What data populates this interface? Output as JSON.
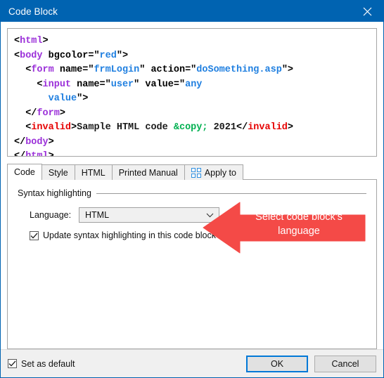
{
  "window": {
    "title": "Code Block",
    "close_icon": "close-icon",
    "titlebar_color": "#0063b1"
  },
  "code_preview": {
    "language_shown": "HTML",
    "colors": {
      "tag": "#9b30d9",
      "invalid_tag": "#e60000",
      "attribute_value": "#1f7fe0",
      "entity": "#00b050",
      "punctuation": "#000000",
      "text": "#1a1a1a"
    },
    "lines": [
      {
        "indent": 0,
        "tokens": [
          {
            "t": "punct",
            "s": "<"
          },
          {
            "t": "tag",
            "s": "html"
          },
          {
            "t": "punct",
            "s": ">"
          }
        ]
      },
      {
        "indent": 0,
        "tokens": [
          {
            "t": "punct",
            "s": "<"
          },
          {
            "t": "tag",
            "s": "body"
          },
          {
            "t": "attr",
            "s": " bgcolor="
          },
          {
            "t": "punct",
            "s": "\""
          },
          {
            "t": "val",
            "s": "red"
          },
          {
            "t": "punct",
            "s": "\">"
          }
        ]
      },
      {
        "indent": 1,
        "tokens": [
          {
            "t": "punct",
            "s": "<"
          },
          {
            "t": "tag",
            "s": "form"
          },
          {
            "t": "attr",
            "s": " name="
          },
          {
            "t": "punct",
            "s": "\""
          },
          {
            "t": "val",
            "s": "frmLogin"
          },
          {
            "t": "punct",
            "s": "\""
          },
          {
            "t": "attr",
            "s": " action="
          },
          {
            "t": "punct",
            "s": "\""
          },
          {
            "t": "val",
            "s": "doSomething.asp"
          },
          {
            "t": "punct",
            "s": "\">"
          }
        ]
      },
      {
        "indent": 2,
        "tokens": [
          {
            "t": "punct",
            "s": "<"
          },
          {
            "t": "tag",
            "s": "input"
          },
          {
            "t": "attr",
            "s": " name="
          },
          {
            "t": "punct",
            "s": "\""
          },
          {
            "t": "val",
            "s": "user"
          },
          {
            "t": "punct",
            "s": "\""
          },
          {
            "t": "attr",
            "s": " value="
          },
          {
            "t": "punct",
            "s": "\""
          },
          {
            "t": "val",
            "s": "any"
          }
        ]
      },
      {
        "indent": 3,
        "tokens": [
          {
            "t": "val",
            "s": "value"
          },
          {
            "t": "punct",
            "s": "\">"
          }
        ]
      },
      {
        "indent": 1,
        "tokens": [
          {
            "t": "punct",
            "s": "</"
          },
          {
            "t": "tag",
            "s": "form"
          },
          {
            "t": "punct",
            "s": ">"
          }
        ]
      },
      {
        "indent": 1,
        "tokens": [
          {
            "t": "punct",
            "s": "<"
          },
          {
            "t": "tag-bad",
            "s": "invalid"
          },
          {
            "t": "punct",
            "s": ">"
          },
          {
            "t": "text",
            "s": "Sample HTML code "
          },
          {
            "t": "ent",
            "s": "&copy;"
          },
          {
            "t": "text",
            "s": " 2021"
          },
          {
            "t": "punct",
            "s": "</"
          },
          {
            "t": "tag-bad",
            "s": "invalid"
          },
          {
            "t": "punct",
            "s": ">"
          }
        ]
      },
      {
        "indent": 0,
        "tokens": [
          {
            "t": "punct",
            "s": "</"
          },
          {
            "t": "tag",
            "s": "body"
          },
          {
            "t": "punct",
            "s": ">"
          }
        ]
      },
      {
        "indent": 0,
        "tokens": [
          {
            "t": "punct",
            "s": "</"
          },
          {
            "t": "tag",
            "s": "html"
          },
          {
            "t": "punct",
            "s": ">"
          }
        ]
      }
    ]
  },
  "tabs": [
    {
      "label": "Code",
      "active": true,
      "icon": null
    },
    {
      "label": "Style",
      "active": false,
      "icon": null
    },
    {
      "label": "HTML",
      "active": false,
      "icon": null
    },
    {
      "label": "Printed Manual",
      "active": false,
      "icon": null
    },
    {
      "label": "Apply to",
      "active": false,
      "icon": "grid-icon"
    }
  ],
  "code_tab": {
    "group_title": "Syntax highlighting",
    "language_label": "Language:",
    "language_value": "HTML",
    "language_options": [
      "HTML"
    ],
    "update_checkbox_label": "Update syntax highlighting in this code block",
    "update_checkbox_checked": true
  },
  "callout": {
    "text_line1": "Select code block's",
    "text_line2": "language",
    "color": "#f44a47",
    "direction": "left"
  },
  "footer": {
    "set_as_default_label": "Set as default",
    "set_as_default_checked": true,
    "ok_label": "OK",
    "cancel_label": "Cancel"
  }
}
